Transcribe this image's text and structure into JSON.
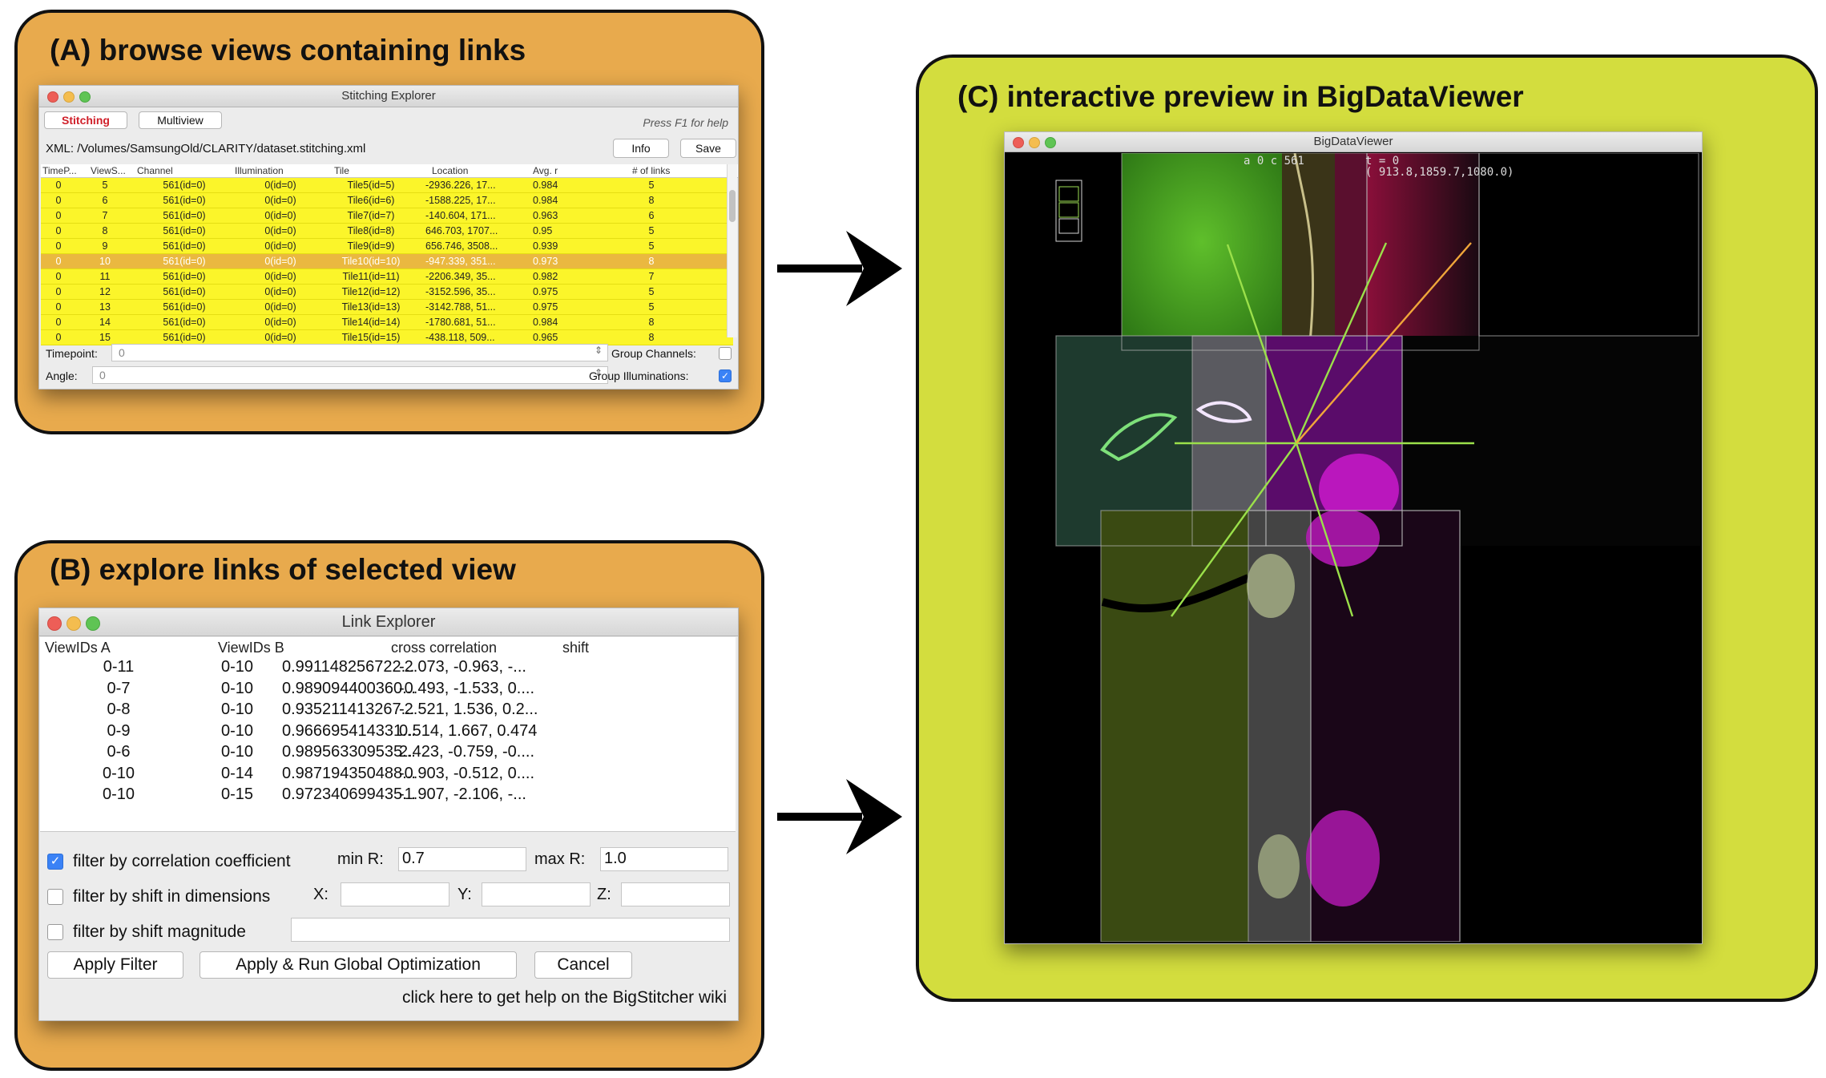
{
  "panel_a": {
    "title": "(A) browse views containing links",
    "window": {
      "title": "Stitching Explorer",
      "tabs": [
        "Stitching",
        "Multiview"
      ],
      "help_hint": "Press F1 for help",
      "xml_label": "XML:",
      "xml_path": "/Volumes/SamsungOld/CLARITY/dataset.stitching.xml",
      "info_button": "Info",
      "save_button": "Save",
      "columns": [
        "TimeP...",
        "ViewS...",
        "Channel",
        "Illumination",
        "Tile",
        "Location",
        "Avg. r",
        "# of links"
      ],
      "rows": [
        [
          "0",
          "5",
          "561(id=0)",
          "0(id=0)",
          "Tile5(id=5)",
          "-2936.226, 17...",
          "0.984",
          "5"
        ],
        [
          "0",
          "6",
          "561(id=0)",
          "0(id=0)",
          "Tile6(id=6)",
          "-1588.225, 17...",
          "0.984",
          "8"
        ],
        [
          "0",
          "7",
          "561(id=0)",
          "0(id=0)",
          "Tile7(id=7)",
          "-140.604, 171...",
          "0.963",
          "6"
        ],
        [
          "0",
          "8",
          "561(id=0)",
          "0(id=0)",
          "Tile8(id=8)",
          "646.703, 1707...",
          "0.95",
          "5"
        ],
        [
          "0",
          "9",
          "561(id=0)",
          "0(id=0)",
          "Tile9(id=9)",
          "656.746, 3508...",
          "0.939",
          "5"
        ],
        [
          "0",
          "10",
          "561(id=0)",
          "0(id=0)",
          "Tile10(id=10)",
          "-947.339, 351...",
          "0.973",
          "8"
        ],
        [
          "0",
          "11",
          "561(id=0)",
          "0(id=0)",
          "Tile11(id=11)",
          "-2206.349, 35...",
          "0.982",
          "7"
        ],
        [
          "0",
          "12",
          "561(id=0)",
          "0(id=0)",
          "Tile12(id=12)",
          "-3152.596, 35...",
          "0.975",
          "5"
        ],
        [
          "0",
          "13",
          "561(id=0)",
          "0(id=0)",
          "Tile13(id=13)",
          "-3142.788, 51...",
          "0.975",
          "5"
        ],
        [
          "0",
          "14",
          "561(id=0)",
          "0(id=0)",
          "Tile14(id=14)",
          "-1780.681, 51...",
          "0.984",
          "8"
        ],
        [
          "0",
          "15",
          "561(id=0)",
          "0(id=0)",
          "Tile15(id=15)",
          "-438.118, 509...",
          "0.965",
          "8"
        ]
      ],
      "selected_row": 5,
      "timepoint_label": "Timepoint:",
      "timepoint_value": "0",
      "angle_label": "Angle:",
      "angle_value": "0",
      "group_channels_label": "Group Channels:",
      "group_channels_checked": false,
      "group_illuminations_label": "Group Illuminations:",
      "group_illuminations_checked": true
    }
  },
  "panel_b": {
    "title": "(B) explore links of selected view",
    "window": {
      "title": "Link Explorer",
      "columns": [
        "ViewIDs A",
        "ViewIDs B",
        "cross correlation",
        "shift"
      ],
      "rows": [
        [
          "0-11",
          "0-10",
          "0.991148256722...",
          "-2.073, -0.963, -..."
        ],
        [
          "0-7",
          "0-10",
          "0.989094400360...",
          "-0.493, -1.533, 0...."
        ],
        [
          "0-8",
          "0-10",
          "0.935211413267...",
          "-2.521, 1.536, 0.2..."
        ],
        [
          "0-9",
          "0-10",
          "0.966695414331...",
          "0.514, 1.667, 0.474"
        ],
        [
          "0-6",
          "0-10",
          "0.989563309535...",
          "2.423, -0.759, -0...."
        ],
        [
          "0-10",
          "0-14",
          "0.987194350488...",
          "-0.903, -0.512, 0...."
        ],
        [
          "0-10",
          "0-15",
          "0.972340699435...",
          "-1.907, -2.106, -..."
        ]
      ],
      "filter_corr_label": "filter by correlation coefficient",
      "filter_corr_checked": true,
      "min_r_label": "min R:",
      "min_r_value": "0.7",
      "max_r_label": "max R:",
      "max_r_value": "1.0",
      "filter_shift_label": "filter by shift in dimensions",
      "filter_shift_checked": false,
      "x_label": "X:",
      "y_label": "Y:",
      "z_label": "Z:",
      "filter_mag_label": "filter by shift magnitude",
      "filter_mag_checked": false,
      "apply_filter_button": "Apply Filter",
      "apply_run_button": "Apply & Run Global Optimization",
      "cancel_button": "Cancel",
      "help_link": "click here to get help on the BigStitcher wiki"
    }
  },
  "panel_c": {
    "title": "(C) interactive preview in BigDataViewer",
    "window": {
      "title": "BigDataViewer",
      "overlay_source": "a 0 c 561",
      "overlay_time": "t = 0",
      "overlay_coords": "( 913.8,1859.7,1080.0)"
    }
  },
  "colors": {
    "panel_ab_bg": "#e8aa4d",
    "panel_c_bg": "#d3dd3e",
    "row_highlight": "#fbf52a",
    "row_selected": "#eab840",
    "link_line_green": "#9be04a",
    "link_line_orange": "#f0a63a",
    "tab_active_text": "#d0202a"
  },
  "icons": [
    "close-dot-icon",
    "minimize-dot-icon",
    "zoom-dot-icon",
    "arrow-right-icon",
    "checkbox-icon",
    "spinner-icon"
  ]
}
